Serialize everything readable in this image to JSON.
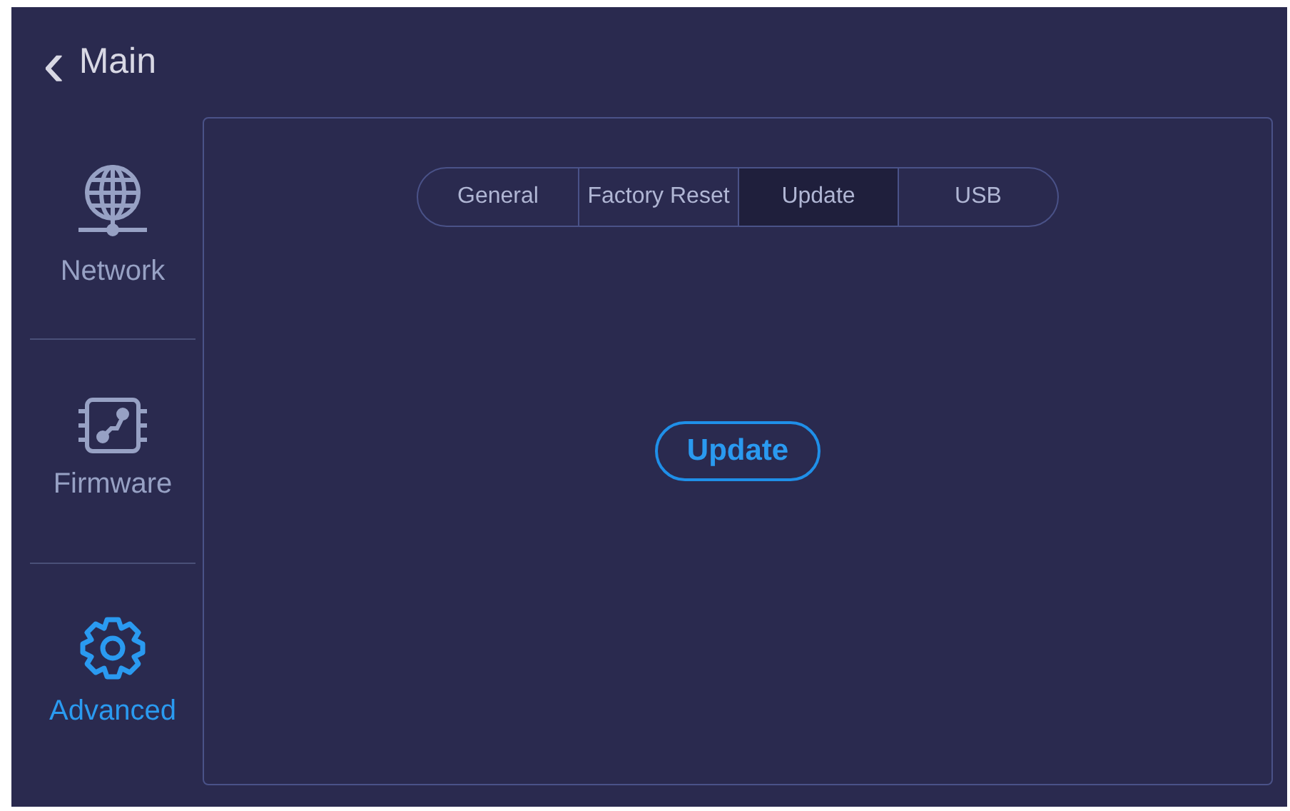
{
  "header": {
    "back_icon": "‹",
    "title": "Main"
  },
  "sidebar": {
    "items": [
      {
        "label": "Network",
        "kind": "network",
        "selected": false
      },
      {
        "label": "Firmware",
        "kind": "firmware",
        "selected": false
      },
      {
        "label": "Advanced",
        "kind": "advanced",
        "selected": true
      }
    ]
  },
  "tabs": [
    {
      "label": "General",
      "selected": false
    },
    {
      "label": "Factory Reset",
      "selected": false
    },
    {
      "label": "Update",
      "selected": true
    },
    {
      "label": "USB",
      "selected": false
    }
  ],
  "content": {
    "button": "Update"
  }
}
